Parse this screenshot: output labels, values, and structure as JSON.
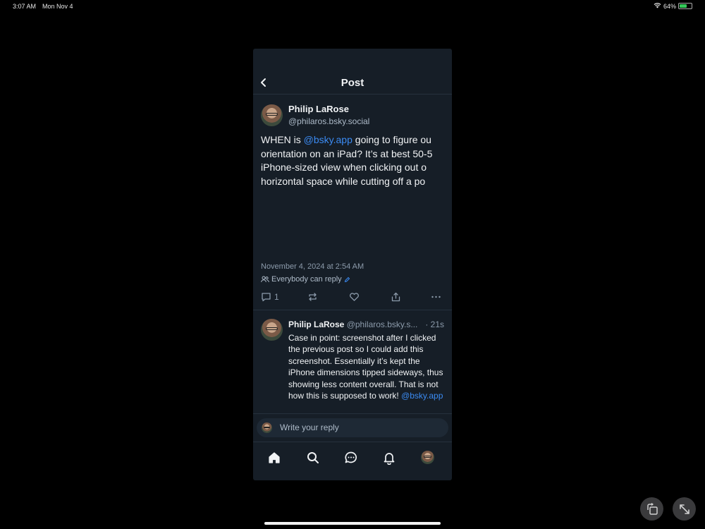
{
  "status_bar": {
    "time": "3:07 AM",
    "date": "Mon Nov 4",
    "battery": "64%",
    "battery_level": 0.64
  },
  "header": {
    "title": "Post"
  },
  "post": {
    "author_name": "Philip LaRose",
    "author_handle": "@philaros.bsky.social",
    "text_lines": [
      {
        "before": "WHEN is ",
        "mention": "@bsky.app",
        "after": " going to figure ou"
      },
      {
        "before": "orientation on an iPad? It’s at best 50-5"
      },
      {
        "before": "iPhone-sized view when clicking out o"
      },
      {
        "before": "horizontal space while cutting off a po"
      }
    ],
    "timestamp": "November 4, 2024 at 2:54 AM",
    "reply_setting": "Everybody can reply",
    "reply_count": "1"
  },
  "reply": {
    "author_name": "Philip LaRose",
    "author_handle": "@philaros.bsky.s...",
    "time": "· 21s",
    "text": "Case in point: screenshot after I clicked the previous post so I could add this screenshot. Essentially it’s kept the iPhone dimensions tipped sideways, thus showing less content overall. That is not how this is supposed to work! ",
    "mention": "@bsky.app"
  },
  "composer": {
    "placeholder": "Write your reply"
  },
  "colors": {
    "background": "#000000",
    "panel": "#161e27",
    "accent": "#3b8bf3",
    "muted": "#8c9bab"
  },
  "tabs": [
    "home-icon",
    "search-icon",
    "chat-icon",
    "bell-icon",
    "profile-avatar"
  ]
}
